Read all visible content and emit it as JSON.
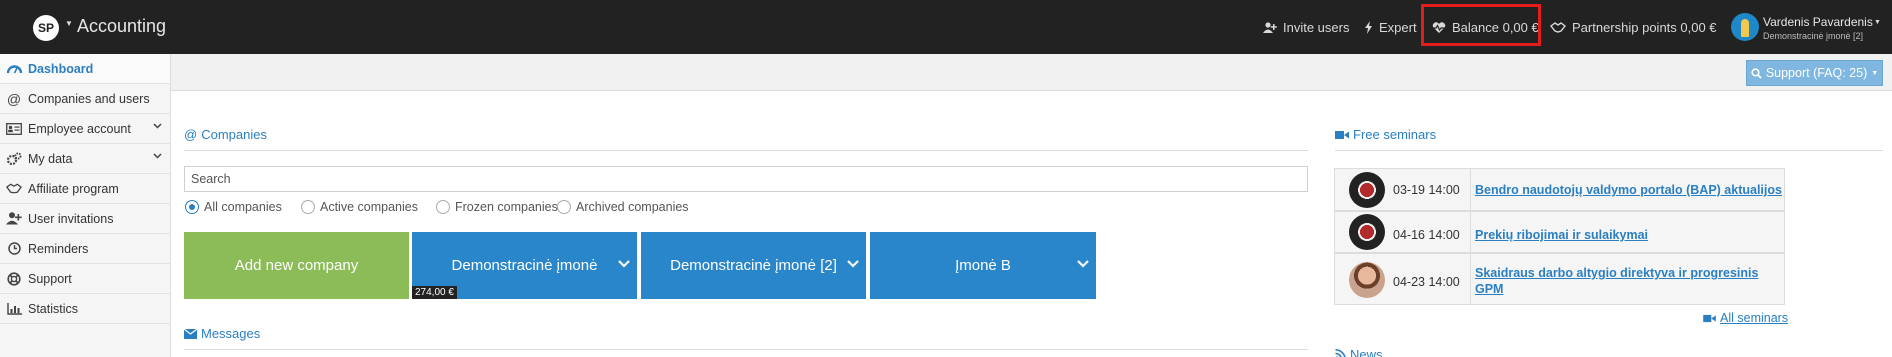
{
  "app": {
    "logo": "SP",
    "title": "Accounting"
  },
  "topbar": {
    "invite": "Invite users",
    "expert": "Expert",
    "balance": "Balance 0,00 €",
    "partnership": "Partnership points 0,00 €",
    "user_name": "Vardenis Pavardenis",
    "user_company": "Demonstracinė įmonė [2]"
  },
  "sidebar": {
    "items": [
      {
        "label": "Dashboard",
        "icon": "dashboard-icon"
      },
      {
        "label": "Companies and users",
        "icon": "at-icon"
      },
      {
        "label": "Employee account",
        "icon": "id-card-icon"
      },
      {
        "label": "My data",
        "icon": "gears-icon"
      },
      {
        "label": "Affiliate program",
        "icon": "handshake-icon"
      },
      {
        "label": "User invitations",
        "icon": "user-plus-icon"
      },
      {
        "label": "Reminders",
        "icon": "clock-icon"
      },
      {
        "label": "Support",
        "icon": "life-ring-icon"
      },
      {
        "label": "Statistics",
        "icon": "bar-chart-icon"
      }
    ]
  },
  "support": {
    "label": "Support (FAQ: 25)"
  },
  "companies": {
    "title": "Companies",
    "search_placeholder": "Search",
    "filters": [
      "All companies",
      "Active companies",
      "Frozen companies",
      "Archived companies"
    ],
    "selected_filter": "All companies",
    "add_label": "Add new company",
    "tiles": [
      {
        "name": "Demonstracinė įmonė",
        "balance": "274,00 €"
      },
      {
        "name": "Demonstracinė įmonė [2]",
        "balance": ""
      },
      {
        "name": "Įmonė B",
        "balance": ""
      }
    ]
  },
  "messages": {
    "title": "Messages"
  },
  "seminars": {
    "title": "Free seminars",
    "items": [
      {
        "date": "03-19 14:00",
        "title": "Bendro naudotojų valdymo portalo (BAP) aktualijos",
        "image": "crest"
      },
      {
        "date": "04-16 14:00",
        "title": "Prekių ribojimai ir sulaikymai",
        "image": "crest"
      },
      {
        "date": "04-23 14:00",
        "title": "Skaidraus darbo altygio direktyva ir progresinis GPM",
        "image": "person"
      }
    ],
    "all_label": "All seminars"
  },
  "news": {
    "title": "News"
  },
  "colors": {
    "topbar": "#222222",
    "accent": "#2a7fc3",
    "add_tile": "#8bbc57",
    "company_tile": "#2a86cb",
    "highlight": "#e31c1c"
  }
}
